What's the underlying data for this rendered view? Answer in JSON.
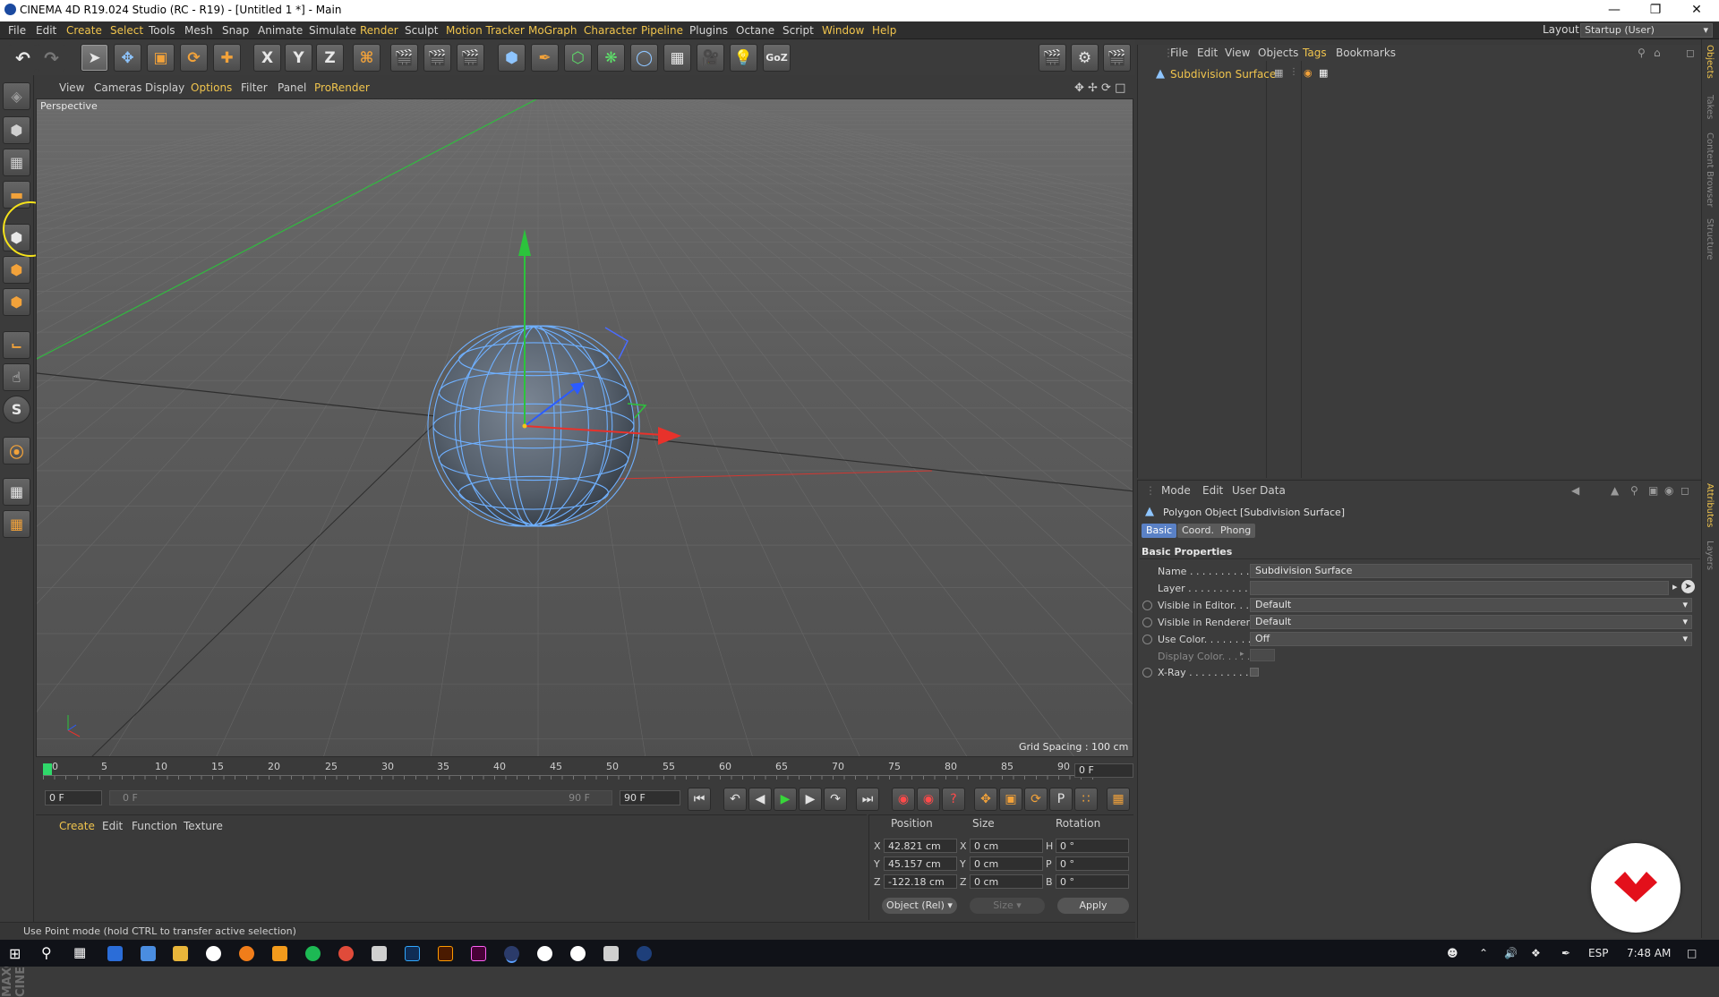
{
  "window": {
    "title": "CINEMA 4D R19.024 Studio (RC - R19) - [Untitled 1 *] - Main"
  },
  "menu": [
    "File",
    "Edit",
    "Create",
    "Select",
    "Tools",
    "Mesh",
    "Snap",
    "Animate",
    "Simulate",
    "Render",
    "Sculpt",
    "Motion Tracker",
    "MoGraph",
    "Character",
    "Pipeline",
    "Plugins",
    "Octane",
    "Script",
    "Window",
    "Help"
  ],
  "layout": {
    "label": "Layout:",
    "value": "Startup (User)"
  },
  "toolbar": {
    "axis_x": "X",
    "axis_y": "Y",
    "axis_z": "Z"
  },
  "viewport": {
    "menu": [
      "View",
      "Cameras",
      "Display",
      "Options",
      "Filter",
      "Panel",
      "ProRender"
    ],
    "label": "Perspective",
    "grid_spacing": "Grid Spacing : 100 cm"
  },
  "timeline": {
    "ticks": [
      "0",
      "5",
      "10",
      "15",
      "20",
      "25",
      "30",
      "35",
      "40",
      "45",
      "50",
      "55",
      "60",
      "65",
      "70",
      "75",
      "80",
      "85",
      "90"
    ],
    "current_frame": "0 F",
    "start_field": "0 F",
    "range_start": "0 F",
    "range_end": "90 F",
    "end_field": "90 F"
  },
  "material_manager": {
    "menu": [
      "Create",
      "Edit",
      "Function",
      "Texture"
    ]
  },
  "coordinates": {
    "headers": [
      "Position",
      "Size",
      "Rotation"
    ],
    "rows": [
      {
        "axis": "X",
        "position": "42.821 cm",
        "size_axis": "X",
        "size": "0 cm",
        "rot_axis": "H",
        "rotation": "0 °"
      },
      {
        "axis": "Y",
        "position": "45.157 cm",
        "size_axis": "Y",
        "size": "0 cm",
        "rot_axis": "P",
        "rotation": "0 °"
      },
      {
        "axis": "Z",
        "position": "-122.18 cm",
        "size_axis": "Z",
        "size": "0 cm",
        "rot_axis": "B",
        "rotation": "0 °"
      }
    ],
    "mode": "Object (Rel)",
    "size_mode": "Size",
    "apply": "Apply"
  },
  "status": "Use Point mode (hold CTRL to transfer active selection)",
  "object_manager": {
    "menu": [
      "File",
      "Edit",
      "View",
      "Objects",
      "Tags",
      "Bookmarks"
    ],
    "object_name": "Subdivision Surface"
  },
  "attributes": {
    "menu": [
      "Mode",
      "Edit",
      "User Data"
    ],
    "object_title": "Polygon Object [Subdivision Surface]",
    "tabs": [
      "Basic",
      "Coord.",
      "Phong"
    ],
    "section": "Basic Properties",
    "props": [
      {
        "label": "Name . . . . . . . . . . . .",
        "value": "Subdivision Surface"
      },
      {
        "label": "Layer . . . . . . . . . . . .",
        "value": ""
      },
      {
        "label": "Visible in Editor. . .",
        "value": "Default"
      },
      {
        "label": "Visible in Renderer",
        "value": "Default"
      },
      {
        "label": "Use Color. . . . . . . .",
        "value": "Off"
      },
      {
        "label": "Display Color. . . . .",
        "value": ""
      },
      {
        "label": "X-Ray . . . . . . . . . . .",
        "value": ""
      }
    ]
  },
  "side_tabs": [
    "Objects",
    "Takes",
    "Content Browser",
    "Structure",
    "Attributes",
    "Layers"
  ],
  "taskbar": {
    "language": "ESP",
    "time": "7:48 AM"
  },
  "colors": {
    "accent": "#f0c44d",
    "axis_x": "#e8322b",
    "axis_y": "#2cc33c",
    "axis_z": "#2b5bff",
    "wire": "#6fb0ff"
  }
}
